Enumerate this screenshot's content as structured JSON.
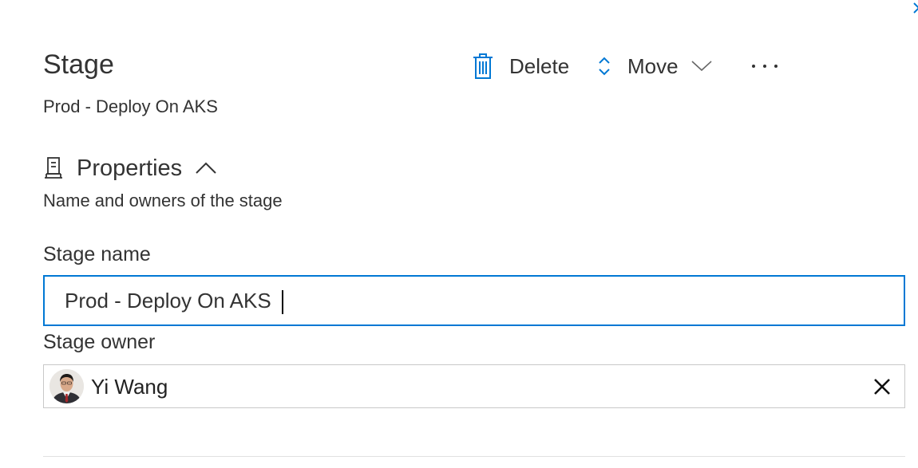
{
  "panel": {
    "title": "Stage",
    "subtitle": "Prod - Deploy On AKS"
  },
  "toolbar": {
    "delete_label": "Delete",
    "move_label": "Move",
    "more_label": "···"
  },
  "properties": {
    "title": "Properties",
    "description": "Name and owners of the stage"
  },
  "form": {
    "stage_name_label": "Stage name",
    "stage_name_value": "Prod - Deploy On AKS",
    "stage_owner_label": "Stage owner",
    "stage_owner_value": "Yi Wang"
  },
  "colors": {
    "accent": "#0078d4",
    "text": "#333333",
    "border": "#c8c8c8"
  },
  "icons": {
    "delete": "trash-icon",
    "move": "up-down-arrows-icon",
    "move_dropdown": "chevron-down-icon",
    "more": "more-horizontal-icon",
    "properties": "properties-icon",
    "collapse": "chevron-up-icon",
    "remove_owner": "close-icon"
  }
}
